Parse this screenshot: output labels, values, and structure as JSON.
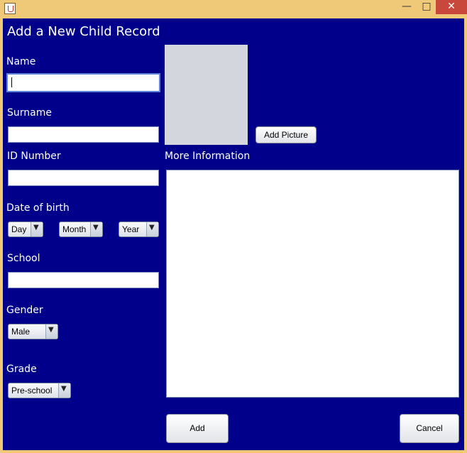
{
  "window": {
    "title": "",
    "icon": "java-coffee-cup-icon",
    "controls": [
      "minimize",
      "maximize",
      "close"
    ]
  },
  "form": {
    "heading": "Add a New Child Record",
    "name_label": "Name",
    "name_value": "",
    "surname_label": "Surname",
    "surname_value": "",
    "id_label": "ID Number",
    "id_value": "",
    "dob_label": "Date of birth",
    "day_value": "Day",
    "month_value": "Month",
    "year_value": "Year",
    "school_label": "School",
    "school_value": "",
    "gender_label": "Gender",
    "gender_value": "Male",
    "grade_label": "Grade",
    "grade_value": "Pre-school",
    "add_picture_label": "Add Picture",
    "more_info_label": "More Information",
    "more_info_value": "",
    "add_button_label": "Add",
    "cancel_button_label": "Cancel"
  },
  "colors": {
    "background": "#00008b",
    "title_bar": "#f0c978",
    "close_button": "#c9483c"
  }
}
